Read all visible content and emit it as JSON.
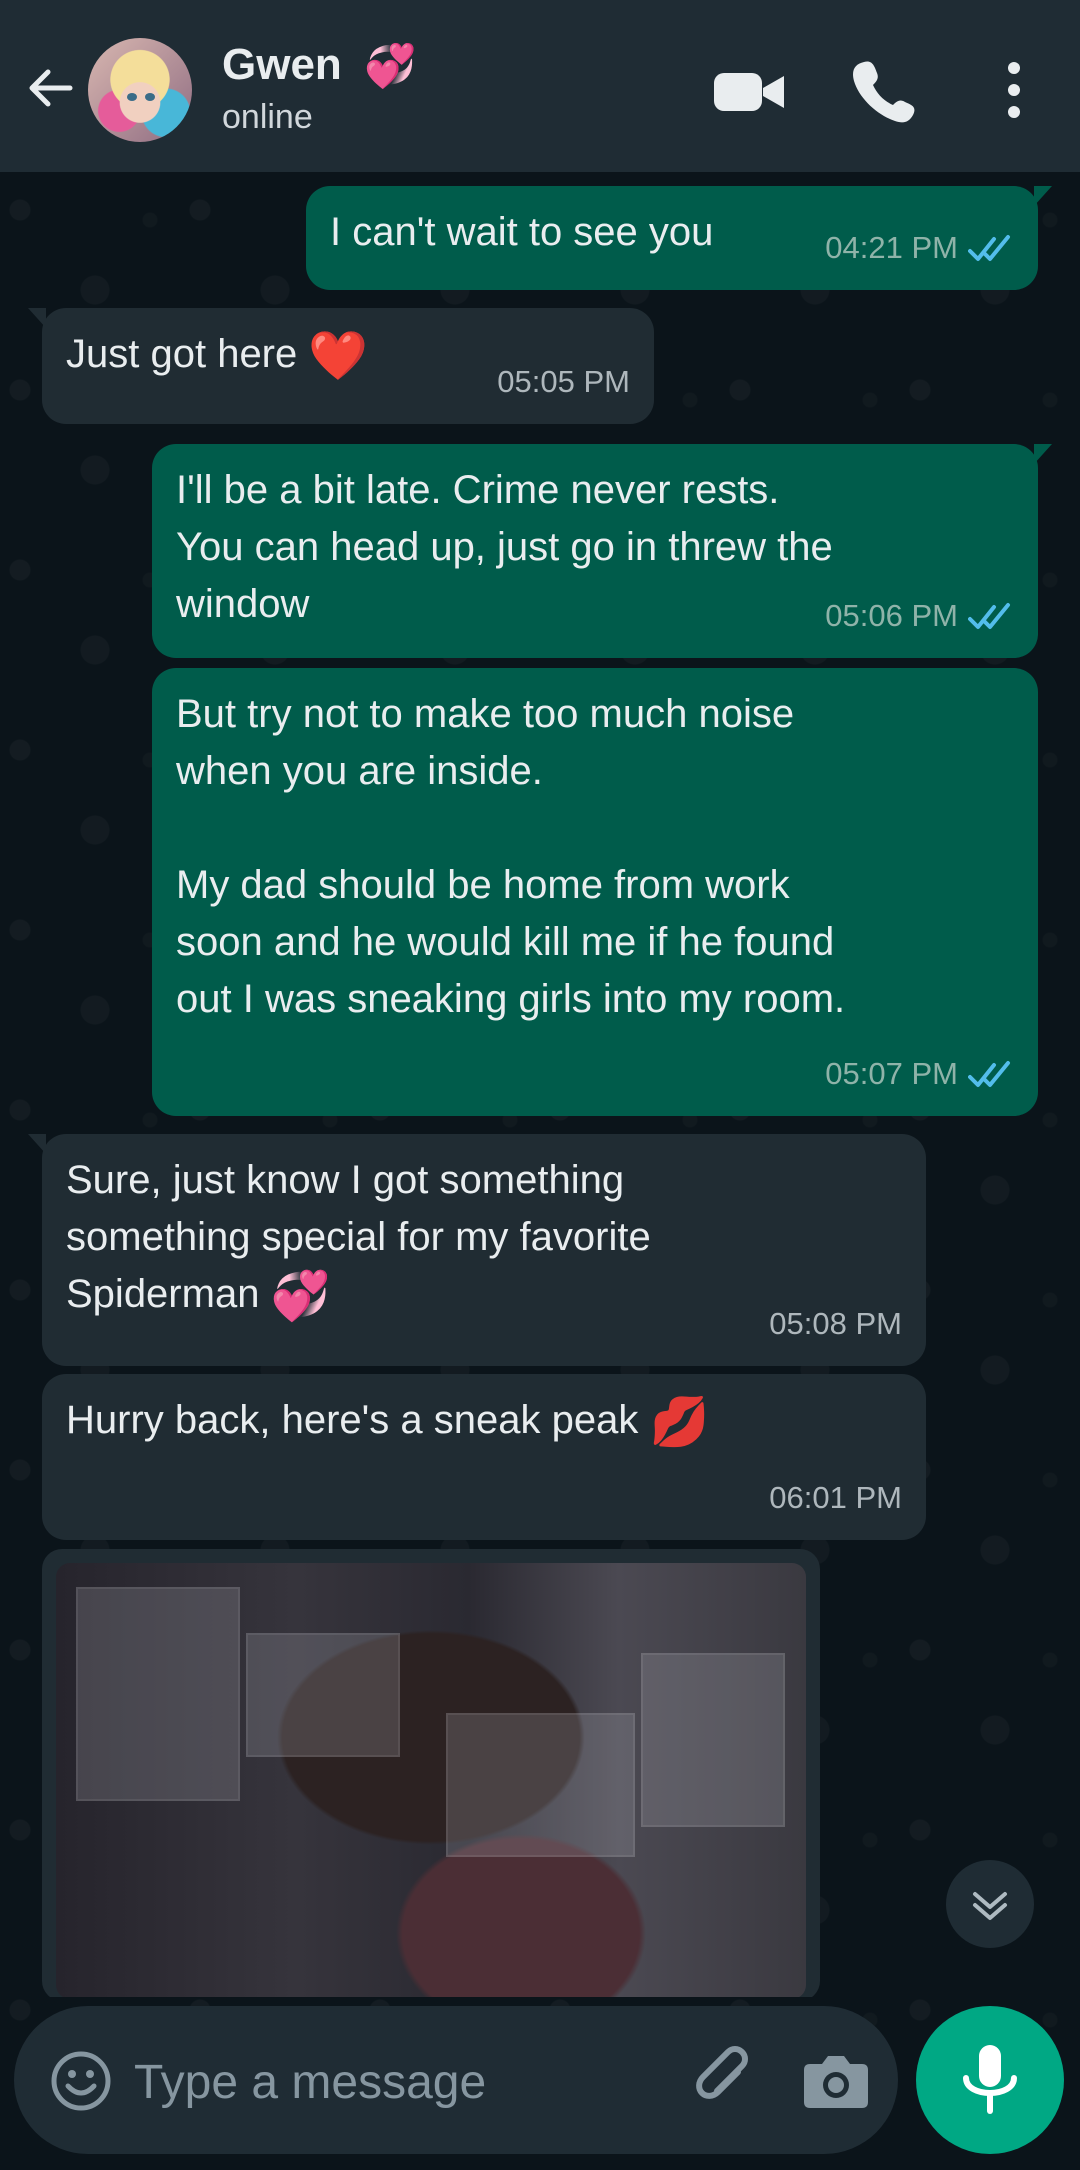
{
  "header": {
    "contact_name": "Gwen",
    "contact_emoji": "💞",
    "status": "online"
  },
  "messages": [
    {
      "direction": "sent",
      "text": "I can't wait to see you",
      "time": "04:21 PM",
      "read": true
    },
    {
      "direction": "received",
      "text": "Just got here",
      "emoji": "❤️",
      "time": "05:05 PM"
    },
    {
      "direction": "sent",
      "text": "I'll be a bit late. Crime never rests.\nYou can head up, just go in threw the\nwindow",
      "time": "05:06 PM",
      "read": true
    },
    {
      "direction": "sent",
      "text": "But try not to make too much noise\nwhen you are inside.\n\nMy dad should be home from work\nsoon and he would kill me if he found\nout I was sneaking girls into my room.",
      "time": "05:07 PM",
      "read": true
    },
    {
      "direction": "received",
      "text": "Sure, just know I got something\nsomething special for my favorite\nSpiderman",
      "emoji": "💞",
      "time": "05:08 PM"
    },
    {
      "direction": "received",
      "text": "Hurry back, here's a sneak peak",
      "emoji": "💋",
      "time": "06:01 PM"
    }
  ],
  "composer": {
    "placeholder": "Type a message"
  },
  "colors": {
    "header_bg": "#1f2c34",
    "chat_bg": "#0b141a",
    "sent_bubble": "#005c4b",
    "received_bubble": "#202c33",
    "accent": "#00a884",
    "read_tick": "#53bdeb"
  },
  "icons": {
    "back": "arrow-left-icon",
    "video": "video-camera-icon",
    "call": "phone-icon",
    "menu": "more-vertical-icon",
    "scroll_down": "double-chevron-down-icon",
    "emoji": "smiley-icon",
    "attach": "paperclip-icon",
    "camera": "camera-icon",
    "mic": "microphone-icon"
  }
}
